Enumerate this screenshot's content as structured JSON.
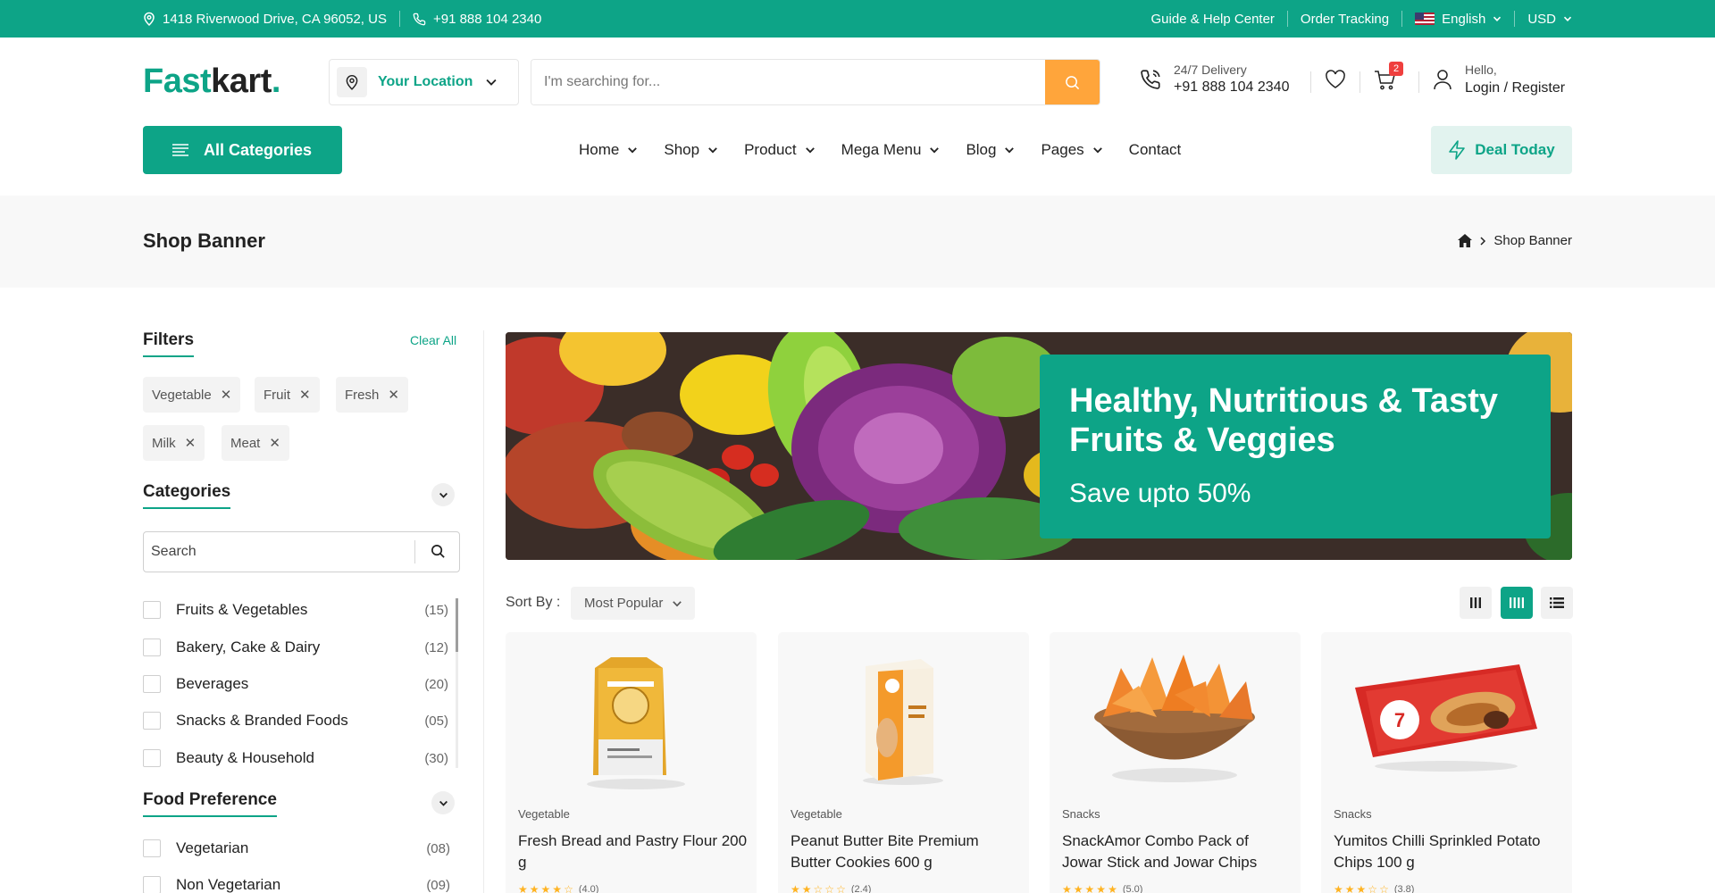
{
  "topbar": {
    "address": "1418 Riverwood Drive, CA 96052, US",
    "phone": "+91 888 104 2340",
    "help": "Guide & Help Center",
    "tracking": "Order Tracking",
    "language": "English",
    "currency": "USD"
  },
  "header": {
    "logo_part1": "Fast",
    "logo_part2": "kart",
    "logo_dot": ".",
    "location_label": "Your Location",
    "search_placeholder": "I'm searching for...",
    "delivery_label": "24/7 Delivery",
    "delivery_phone": "+91 888 104 2340",
    "cart_count": "2",
    "user_greeting": "Hello,",
    "user_action": "Login / Register"
  },
  "nav": {
    "all_categories": "All Categories",
    "items": [
      {
        "label": "Home",
        "dropdown": true
      },
      {
        "label": "Shop",
        "dropdown": true
      },
      {
        "label": "Product",
        "dropdown": true
      },
      {
        "label": "Mega Menu",
        "dropdown": true
      },
      {
        "label": "Blog",
        "dropdown": true
      },
      {
        "label": "Pages",
        "dropdown": true
      },
      {
        "label": "Contact",
        "dropdown": false
      }
    ],
    "deal": "Deal Today"
  },
  "page": {
    "title": "Shop Banner",
    "breadcrumb_current": "Shop Banner"
  },
  "filters": {
    "title": "Filters",
    "clear_all": "Clear All",
    "tags": [
      "Vegetable",
      "Fruit",
      "Fresh",
      "Milk",
      "Meat"
    ],
    "categories_title": "Categories",
    "search_placeholder": "Search",
    "categories": [
      {
        "label": "Fruits & Vegetables",
        "count": "(15)"
      },
      {
        "label": "Bakery, Cake & Dairy",
        "count": "(12)"
      },
      {
        "label": "Beverages",
        "count": "(20)"
      },
      {
        "label": "Snacks & Branded Foods",
        "count": "(05)"
      },
      {
        "label": "Beauty & Household",
        "count": "(30)"
      }
    ],
    "food_pref_title": "Food Preference",
    "food_pref": [
      {
        "label": "Vegetarian",
        "count": "(08)"
      },
      {
        "label": "Non Vegetarian",
        "count": "(09)"
      }
    ]
  },
  "banner": {
    "heading_line1": "Healthy, Nutritious & Tasty",
    "heading_line2": "Fruits & Veggies",
    "subheading": "Save upto 50%"
  },
  "sort": {
    "label": "Sort By :",
    "selected": "Most Popular"
  },
  "products": [
    {
      "category": "Vegetable",
      "name": "Fresh Bread and Pastry Flour 200 g",
      "rating": 4.0,
      "rating_text": "(4.0)"
    },
    {
      "category": "Vegetable",
      "name": "Peanut Butter Bite Premium Butter Cookies 600 g",
      "rating": 2.4,
      "rating_text": "(2.4)"
    },
    {
      "category": "Snacks",
      "name": "SnackAmor Combo Pack of Jowar Stick and Jowar Chips",
      "rating": 5.0,
      "rating_text": "(5.0)"
    },
    {
      "category": "Snacks",
      "name": "Yumitos Chilli Sprinkled Potato Chips 100 g",
      "rating": 3.8,
      "rating_text": "(3.8)"
    }
  ],
  "colors": {
    "primary": "#0da487",
    "accent": "#ffa53b",
    "badge": "#ef3f3e",
    "star": "#ffb321"
  }
}
